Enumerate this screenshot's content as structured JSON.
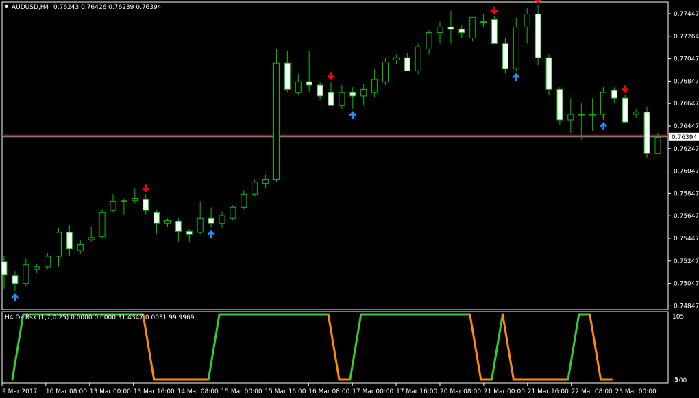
{
  "header": {
    "symbol_title": "AUDUSD,H4",
    "ohlc_text": "0.76243 0.76426 0.76239 0.76394"
  },
  "indicator": {
    "title": "H4 Dz Rsx (1,7,0.25) 0.0000 0.0000 31.4347 0.0031 99.9969"
  },
  "colors": {
    "background": "#000000",
    "bull_outline": "#00c000",
    "bear_fill": "#ffffff",
    "frame": "#ffffff",
    "sell_arrow": "#ff0000",
    "buy_arrow": "#1e90ff",
    "rsx_up": "#32cd32",
    "rsx_down": "#ff8c00",
    "price_line": "#ff0000"
  },
  "chart_data": {
    "type": "candlestick",
    "price_axis": {
      "ticks": [
        "0.77447",
        "0.77264",
        "0.77047",
        "0.76847",
        "0.76647",
        "0.76447",
        "0.76247",
        "0.76047",
        "0.75847",
        "0.75647",
        "0.75447",
        "0.75247",
        "0.75047",
        "0.74847"
      ],
      "range": [
        0.7481,
        0.7763
      ],
      "current_price": "0.76394",
      "reference_level": 0.7641
    },
    "time_axis": {
      "ticks": [
        "9 Mar 2017",
        "10 Mar 08:00",
        "13 Mar 00:00",
        "13 Mar 16:00",
        "14 Mar 08:00",
        "15 Mar 00:00",
        "15 Mar 16:00",
        "16 Mar 08:00",
        "17 Mar 00:00",
        "17 Mar 16:00",
        "20 Mar 08:00",
        "21 Mar 00:00",
        "21 Mar 16:00",
        "22 Mar 08:00",
        "23 Mar 00:00"
      ]
    },
    "candles": [
      {
        "o": 0.7525,
        "h": 0.753,
        "l": 0.75,
        "c": 0.7513
      },
      {
        "o": 0.7512,
        "h": 0.7516,
        "l": 0.7498,
        "c": 0.7505
      },
      {
        "o": 0.7505,
        "h": 0.7528,
        "l": 0.7503,
        "c": 0.7522
      },
      {
        "o": 0.7518,
        "h": 0.7523,
        "l": 0.7515,
        "c": 0.752
      },
      {
        "o": 0.752,
        "h": 0.7533,
        "l": 0.7518,
        "c": 0.753
      },
      {
        "o": 0.753,
        "h": 0.7556,
        "l": 0.752,
        "c": 0.7552
      },
      {
        "o": 0.7552,
        "h": 0.7558,
        "l": 0.753,
        "c": 0.7537
      },
      {
        "o": 0.7535,
        "h": 0.7545,
        "l": 0.7532,
        "c": 0.7541
      },
      {
        "o": 0.7545,
        "h": 0.7557,
        "l": 0.7543,
        "c": 0.7547
      },
      {
        "o": 0.7548,
        "h": 0.7573,
        "l": 0.7546,
        "c": 0.757
      },
      {
        "o": 0.7572,
        "h": 0.7587,
        "l": 0.757,
        "c": 0.758
      },
      {
        "o": 0.758,
        "h": 0.7583,
        "l": 0.7568,
        "c": 0.7581
      },
      {
        "o": 0.7581,
        "h": 0.7592,
        "l": 0.7578,
        "c": 0.7583
      },
      {
        "o": 0.7582,
        "h": 0.7587,
        "l": 0.7568,
        "c": 0.7572
      },
      {
        "o": 0.757,
        "h": 0.7572,
        "l": 0.755,
        "c": 0.756
      },
      {
        "o": 0.756,
        "h": 0.7565,
        "l": 0.7557,
        "c": 0.7563
      },
      {
        "o": 0.7562,
        "h": 0.7565,
        "l": 0.7543,
        "c": 0.7553
      },
      {
        "o": 0.7553,
        "h": 0.7555,
        "l": 0.7543,
        "c": 0.755
      },
      {
        "o": 0.7552,
        "h": 0.758,
        "l": 0.755,
        "c": 0.7565
      },
      {
        "o": 0.7565,
        "h": 0.7575,
        "l": 0.7556,
        "c": 0.756
      },
      {
        "o": 0.756,
        "h": 0.7571,
        "l": 0.7556,
        "c": 0.7567
      },
      {
        "o": 0.7565,
        "h": 0.7577,
        "l": 0.7563,
        "c": 0.7575
      },
      {
        "o": 0.7575,
        "h": 0.759,
        "l": 0.7573,
        "c": 0.7587
      },
      {
        "o": 0.7587,
        "h": 0.76,
        "l": 0.7585,
        "c": 0.7598
      },
      {
        "o": 0.7597,
        "h": 0.7605,
        "l": 0.7592,
        "c": 0.76
      },
      {
        "o": 0.76,
        "h": 0.772,
        "l": 0.7598,
        "c": 0.7707
      },
      {
        "o": 0.7707,
        "h": 0.7718,
        "l": 0.768,
        "c": 0.7683
      },
      {
        "o": 0.768,
        "h": 0.7697,
        "l": 0.7678,
        "c": 0.769
      },
      {
        "o": 0.769,
        "h": 0.7718,
        "l": 0.768,
        "c": 0.7687
      },
      {
        "o": 0.7687,
        "h": 0.769,
        "l": 0.7673,
        "c": 0.7677
      },
      {
        "o": 0.768,
        "h": 0.769,
        "l": 0.767,
        "c": 0.7668
      },
      {
        "o": 0.7668,
        "h": 0.7687,
        "l": 0.7665,
        "c": 0.768
      },
      {
        "o": 0.768,
        "h": 0.7685,
        "l": 0.7665,
        "c": 0.7677
      },
      {
        "o": 0.7677,
        "h": 0.7688,
        "l": 0.7668,
        "c": 0.7683
      },
      {
        "o": 0.768,
        "h": 0.7702,
        "l": 0.7676,
        "c": 0.7692
      },
      {
        "o": 0.769,
        "h": 0.7712,
        "l": 0.7687,
        "c": 0.7708
      },
      {
        "o": 0.771,
        "h": 0.7715,
        "l": 0.7706,
        "c": 0.7712
      },
      {
        "o": 0.7712,
        "h": 0.7716,
        "l": 0.7701,
        "c": 0.77
      },
      {
        "o": 0.77,
        "h": 0.7725,
        "l": 0.7697,
        "c": 0.7722
      },
      {
        "o": 0.772,
        "h": 0.7737,
        "l": 0.7715,
        "c": 0.7735
      },
      {
        "o": 0.7735,
        "h": 0.7745,
        "l": 0.7725,
        "c": 0.774
      },
      {
        "o": 0.774,
        "h": 0.7755,
        "l": 0.7725,
        "c": 0.7738
      },
      {
        "o": 0.7738,
        "h": 0.7742,
        "l": 0.773,
        "c": 0.7735
      },
      {
        "o": 0.773,
        "h": 0.7748,
        "l": 0.7727,
        "c": 0.7749
      },
      {
        "o": 0.7745,
        "h": 0.7752,
        "l": 0.774,
        "c": 0.7745
      },
      {
        "o": 0.7747,
        "h": 0.775,
        "l": 0.773,
        "c": 0.7725
      },
      {
        "o": 0.7725,
        "h": 0.773,
        "l": 0.7698,
        "c": 0.7702
      },
      {
        "o": 0.7702,
        "h": 0.7748,
        "l": 0.77,
        "c": 0.774
      },
      {
        "o": 0.774,
        "h": 0.7758,
        "l": 0.7725,
        "c": 0.7752
      },
      {
        "o": 0.7752,
        "h": 0.776,
        "l": 0.7705,
        "c": 0.7712
      },
      {
        "o": 0.7712,
        "h": 0.7715,
        "l": 0.7678,
        "c": 0.7683
      },
      {
        "o": 0.7683,
        "h": 0.7685,
        "l": 0.765,
        "c": 0.7655
      },
      {
        "o": 0.7655,
        "h": 0.7675,
        "l": 0.7643,
        "c": 0.766
      },
      {
        "o": 0.766,
        "h": 0.767,
        "l": 0.7637,
        "c": 0.766
      },
      {
        "o": 0.766,
        "h": 0.7675,
        "l": 0.7645,
        "c": 0.766
      },
      {
        "o": 0.766,
        "h": 0.7685,
        "l": 0.7655,
        "c": 0.768
      },
      {
        "o": 0.7682,
        "h": 0.7685,
        "l": 0.767,
        "c": 0.7675
      },
      {
        "o": 0.7675,
        "h": 0.7678,
        "l": 0.7652,
        "c": 0.7653
      },
      {
        "o": 0.766,
        "h": 0.7665,
        "l": 0.7657,
        "c": 0.7662
      },
      {
        "o": 0.7662,
        "h": 0.7667,
        "l": 0.762,
        "c": 0.7624
      },
      {
        "o": 0.7624,
        "h": 0.7643,
        "l": 0.7624,
        "c": 0.7639
      }
    ],
    "sell_arrow_bars": [
      13,
      30,
      45,
      49,
      57
    ],
    "buy_arrow_bars": [
      1,
      19,
      32,
      47,
      55
    ],
    "rsx_axis": {
      "top_label": "105",
      "bottom_label": "-5",
      "bottom_label_2": "100",
      "range": [
        -5,
        105
      ]
    },
    "rsx_values": [
      0,
      100,
      100,
      100,
      100,
      100,
      100,
      100,
      100,
      100,
      100,
      100,
      100,
      0,
      0,
      0,
      0,
      0,
      0,
      100,
      100,
      100,
      100,
      100,
      100,
      100,
      100,
      100,
      100,
      100,
      0,
      0,
      100,
      100,
      100,
      100,
      100,
      100,
      100,
      100,
      100,
      100,
      100,
      0,
      0,
      100,
      0,
      0,
      0,
      0,
      0,
      0,
      100,
      100,
      0,
      0
    ]
  }
}
